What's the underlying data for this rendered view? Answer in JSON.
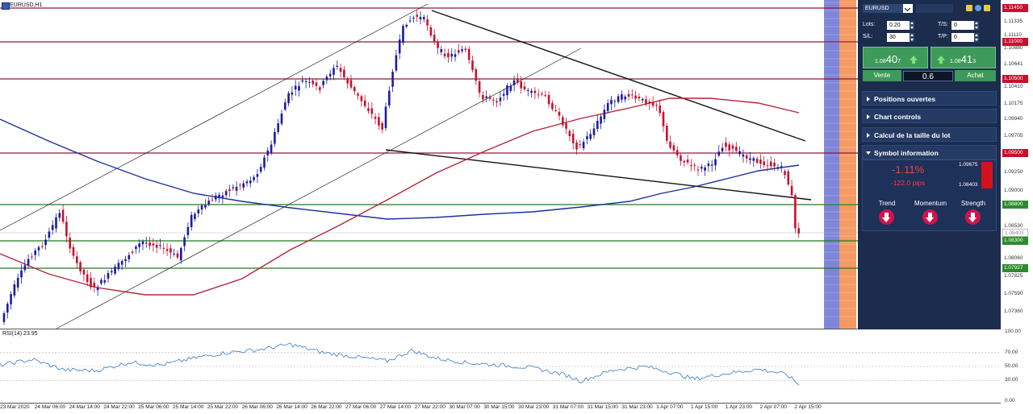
{
  "chart": {
    "title": "EURUSD,H1",
    "rsi_title": "RSI(14) 23.95",
    "colors": {
      "bull": "#1c1ca0",
      "bear": "#c8102e",
      "ma_blue": "#1a2fa0",
      "ma_red": "#b3263a",
      "resistance": "#8b1a3a",
      "support": "#1d7a1d",
      "rsi_line": "#4b86c8",
      "badge_red": "#c8102e",
      "badge_green": "#2f8a2f"
    },
    "price_axis": {
      "labels": [
        "1.11335",
        "1.11110",
        "1.10880",
        "1.10641",
        "1.10410",
        "1.10175",
        "1.09940",
        "1.09705",
        "1.09250",
        "1.09000",
        "1.08530",
        "1.08060",
        "1.07825",
        "1.07590",
        "1.07360"
      ],
      "badges_red": [
        "1.11450",
        "1.11000",
        "1.10500",
        "1.09500"
      ],
      "badges_green": [
        "1.08800",
        "1.08300",
        "1.07927"
      ],
      "current": "1.08403"
    },
    "rsi_axis": [
      "100.00",
      "70.00",
      "50.00",
      "30.00",
      "0.00"
    ],
    "time_axis": [
      "23 Mar 2020",
      "24 Mar 06:00",
      "24 Mar 14:00",
      "24 Mar 22:00",
      "25 Mar 06:00",
      "25 Mar 14:00",
      "25 Mar 22:00",
      "26 Mar 06:00",
      "26 Mar 14:00",
      "26 Mar 22:00",
      "27 Mar 06:00",
      "27 Mar 14:00",
      "27 Mar 22:00",
      "30 Mar 07:00",
      "30 Mar 15:00",
      "30 Mar 23:00",
      "31 Mar 07:00",
      "31 Mar 15:00",
      "31 Mar 23:00",
      "1 Apr 07:00",
      "1 Apr 15:00",
      "1 Apr 23:00",
      "2 Apr 07:00",
      "2 Apr 15:00"
    ]
  },
  "panel": {
    "symbol": "EURUSD",
    "lots_label": "Lots:",
    "lots_value": "0.20",
    "ts_label": "T/S:",
    "ts_value": "0",
    "sl_label": "S/L:",
    "sl_value": "30",
    "tp_label": "T/P:",
    "tp_value": "0",
    "sell_price_prefix": "1.08",
    "sell_price_big": "40",
    "sell_price_suffix": "7",
    "buy_price_prefix": "1.08",
    "buy_price_big": "41",
    "buy_price_suffix": "3",
    "sell_label": "Vente",
    "buy_label": "Achat",
    "spread": "0.6",
    "sections": [
      "Positions ouvertes",
      "Chart controls",
      "Calcul de la taille du lot",
      "Symbol information"
    ],
    "symbol_info": {
      "change_pct": "-1.11%",
      "change_pips": "-122.0 pips",
      "high": "1.09675",
      "low": "1.08403",
      "indicators": [
        "Trend",
        "Momentum",
        "Strength"
      ]
    }
  }
}
